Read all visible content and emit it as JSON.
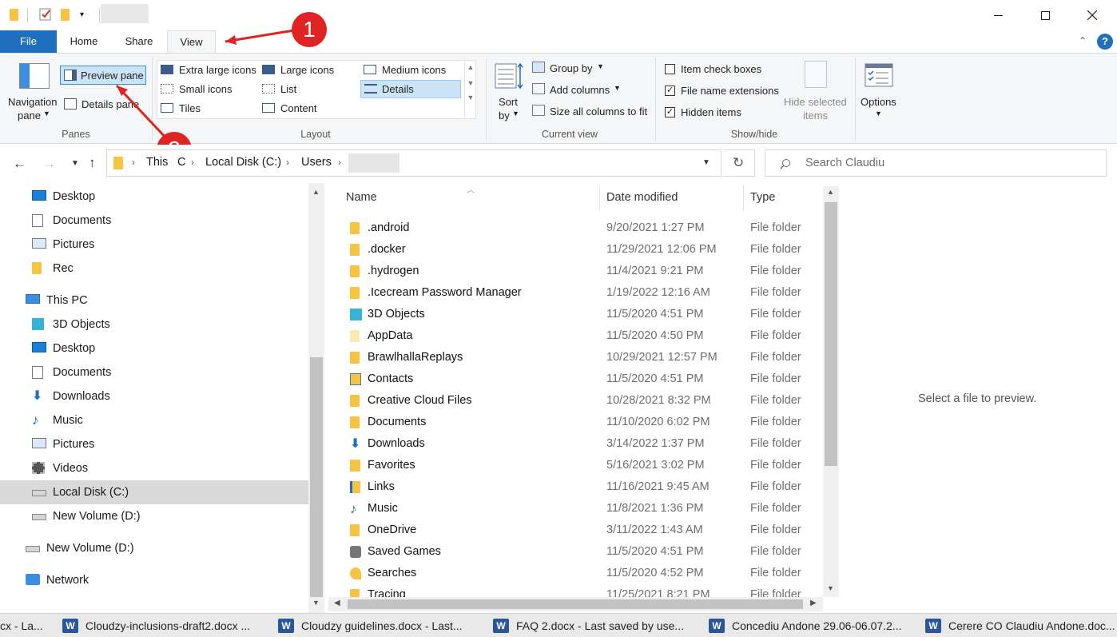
{
  "titlebar": {
    "title": "",
    "controls": [
      "minimize-icon",
      "maximize-icon",
      "close-icon"
    ]
  },
  "tabs": {
    "file": "File",
    "home": "Home",
    "share": "Share",
    "view": "View",
    "active": "View"
  },
  "ribbon": {
    "panes": {
      "navigation_pane_line1": "Navigation",
      "navigation_pane_line2": "pane",
      "preview_pane": "Preview pane",
      "details_pane": "Details pane",
      "label": "Panes"
    },
    "layout": {
      "extra_large_icons": "Extra large icons",
      "large_icons": "Large icons",
      "medium_icons": "Medium icons",
      "small_icons": "Small icons",
      "list": "List",
      "details": "Details",
      "tiles": "Tiles",
      "content": "Content",
      "selected": "Details",
      "label": "Layout"
    },
    "current_view": {
      "sort_by_line1": "Sort",
      "sort_by_line2": "by",
      "group_by": "Group by",
      "add_columns": "Add columns",
      "size_all_columns": "Size all columns to fit",
      "label": "Current view"
    },
    "show_hide": {
      "item_check_boxes": "Item check boxes",
      "item_check_boxes_checked": false,
      "file_name_extensions": "File name extensions",
      "file_name_extensions_checked": true,
      "hidden_items": "Hidden items",
      "hidden_items_checked": true,
      "hide_selected_line1": "Hide selected",
      "hide_selected_line2": "items",
      "label": "Show/hide"
    },
    "options": "Options"
  },
  "annotations": {
    "marker1": "1",
    "marker2": "2",
    "color": "#e02424"
  },
  "address": {
    "crumbs": [
      "This PC",
      "Local Disk (C:)",
      "Users",
      ""
    ],
    "visible_crumb_1": "This",
    "visible_crumb_1_tail": "C",
    "search_placeholder": "Search Claudiu"
  },
  "nav_pane": {
    "items": [
      {
        "label": "Desktop",
        "icon": "desktop-icon",
        "indent": 1
      },
      {
        "label": "Documents",
        "icon": "documents-icon",
        "indent": 1
      },
      {
        "label": "Pictures",
        "icon": "pictures-icon",
        "indent": 1
      },
      {
        "label": "Rec",
        "icon": "folder-icon",
        "indent": 1
      },
      {
        "label": "This PC",
        "icon": "computer-icon",
        "indent": 0
      },
      {
        "label": "3D Objects",
        "icon": "3d-objects-icon",
        "indent": 1
      },
      {
        "label": "Desktop",
        "icon": "desktop-icon",
        "indent": 1
      },
      {
        "label": "Documents",
        "icon": "documents-icon",
        "indent": 1
      },
      {
        "label": "Downloads",
        "icon": "downloads-icon",
        "indent": 1
      },
      {
        "label": "Music",
        "icon": "music-icon",
        "indent": 1
      },
      {
        "label": "Pictures",
        "icon": "pictures-icon",
        "indent": 1
      },
      {
        "label": "Videos",
        "icon": "videos-icon",
        "indent": 1
      },
      {
        "label": "Local Disk (C:)",
        "icon": "drive-icon",
        "indent": 1,
        "selected": true
      },
      {
        "label": "New Volume (D:)",
        "icon": "drive-icon",
        "indent": 1
      },
      {
        "label": "New Volume (D:)",
        "icon": "drive-icon",
        "indent": 0
      },
      {
        "label": "Network",
        "icon": "network-icon",
        "indent": 0
      }
    ]
  },
  "file_list": {
    "columns": {
      "name": "Name",
      "date": "Date modified",
      "type": "Type"
    },
    "rows": [
      {
        "name": ".android",
        "date": "9/20/2021 1:27 PM",
        "type": "File folder",
        "icon": "folder-icon"
      },
      {
        "name": ".docker",
        "date": "11/29/2021 12:06 PM",
        "type": "File folder",
        "icon": "folder-icon"
      },
      {
        "name": ".hydrogen",
        "date": "11/4/2021 9:21 PM",
        "type": "File folder",
        "icon": "folder-icon"
      },
      {
        "name": ".Icecream Password Manager",
        "date": "1/19/2022 12:16 AM",
        "type": "File folder",
        "icon": "folder-icon"
      },
      {
        "name": "3D Objects",
        "date": "11/5/2020 4:51 PM",
        "type": "File folder",
        "icon": "3d-objects-icon"
      },
      {
        "name": "AppData",
        "date": "11/5/2020 4:50 PM",
        "type": "File folder",
        "icon": "folder-hidden-icon"
      },
      {
        "name": "BrawlhallaReplays",
        "date": "10/29/2021 12:57 PM",
        "type": "File folder",
        "icon": "folder-icon"
      },
      {
        "name": "Contacts",
        "date": "11/5/2020 4:51 PM",
        "type": "File folder",
        "icon": "contacts-icon"
      },
      {
        "name": "Creative Cloud Files",
        "date": "10/28/2021 8:32 PM",
        "type": "File folder",
        "icon": "folder-icon"
      },
      {
        "name": "Documents",
        "date": "11/10/2020 6:02 PM",
        "type": "File folder",
        "icon": "folder-icon"
      },
      {
        "name": "Downloads",
        "date": "3/14/2022 1:37 PM",
        "type": "File folder",
        "icon": "downloads-icon"
      },
      {
        "name": "Favorites",
        "date": "5/16/2021 3:02 PM",
        "type": "File folder",
        "icon": "favorites-icon"
      },
      {
        "name": "Links",
        "date": "11/16/2021 9:45 AM",
        "type": "File folder",
        "icon": "links-icon"
      },
      {
        "name": "Music",
        "date": "11/8/2021 1:36 PM",
        "type": "File folder",
        "icon": "music-icon"
      },
      {
        "name": "OneDrive",
        "date": "3/11/2022 1:43 AM",
        "type": "File folder",
        "icon": "folder-icon"
      },
      {
        "name": "Saved Games",
        "date": "11/5/2020 4:51 PM",
        "type": "File folder",
        "icon": "saved-games-icon"
      },
      {
        "name": "Searches",
        "date": "11/5/2020 4:52 PM",
        "type": "File folder",
        "icon": "searches-icon"
      },
      {
        "name": "Tracing",
        "date": "11/25/2021 8:21 PM",
        "type": "File folder",
        "icon": "folder-icon"
      }
    ]
  },
  "preview": {
    "message": "Select a file to preview."
  },
  "taskbar": {
    "items": [
      {
        "label": "cx  -  La...",
        "icon": ""
      },
      {
        "label": "Cloudzy-inclusions-draft2.docx ...",
        "icon": "word-icon"
      },
      {
        "label": "Cloudzy guidelines.docx  -  Last...",
        "icon": "word-icon"
      },
      {
        "label": "FAQ 2.docx  -  Last saved by use...",
        "icon": "word-icon"
      },
      {
        "label": "Concediu Andone 29.06-06.07.2...",
        "icon": "word-icon"
      },
      {
        "label": "Cerere CO Claudiu Andone.doc...",
        "icon": "word-icon"
      }
    ],
    "word_letter": "W"
  }
}
